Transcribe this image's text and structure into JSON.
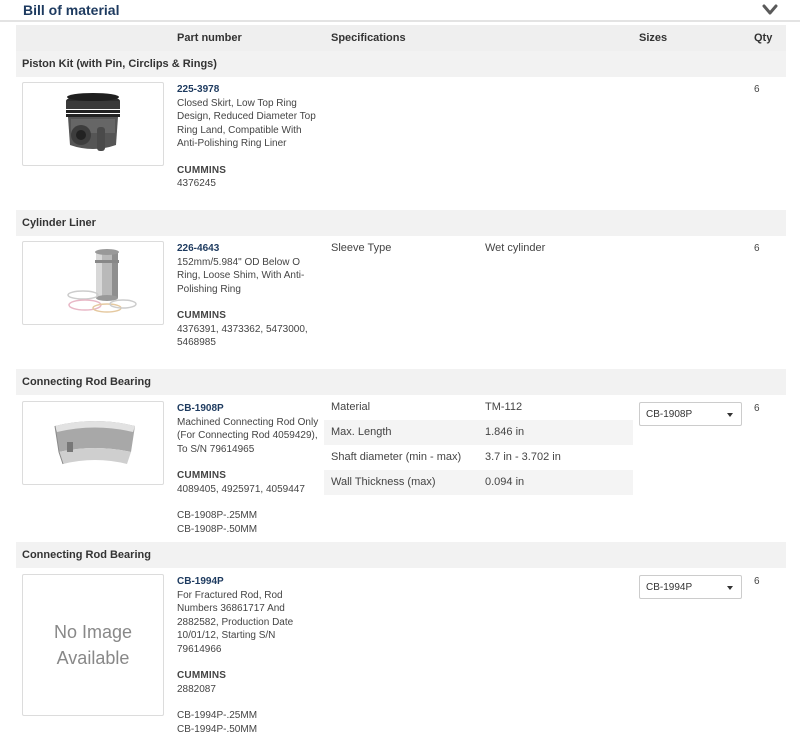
{
  "section_title": "Bill of material",
  "columns": {
    "part_number": "Part number",
    "specifications": "Specifications",
    "sizes": "Sizes",
    "qty": "Qty"
  },
  "groups": [
    {
      "name": "Piston Kit (with Pin, Circlips & Rings)",
      "part_number": "225-3978",
      "description": "Closed Skirt, Low Top Ring Design, Reduced Diameter Top Ring Land, Compatible With Anti-Polishing Ring Liner",
      "brand": "CUMMINS",
      "oem_numbers": "4376245",
      "qty": "6"
    },
    {
      "name": "Cylinder Liner",
      "part_number": "226-4643",
      "description": "152mm/5.984\" OD Below O Ring, Loose Shim, With Anti-Polishing Ring",
      "brand": "CUMMINS",
      "oem_numbers": "4376391, 4373362, 5473000, 5468985",
      "spec_label": "Sleeve Type",
      "spec_value": "Wet cylinder",
      "qty": "6"
    },
    {
      "name": "Connecting Rod Bearing",
      "part_number": "CB-1908P",
      "description": "Machined Connecting Rod Only (For Connecting Rod 4059429), To S/N 79614965",
      "brand": "CUMMINS",
      "oem_numbers": "4089405, 4925971, 4059447",
      "alt1": "CB-1908P-.25MM",
      "alt2": "CB-1908P-.50MM",
      "specs": [
        {
          "label": "Material",
          "value": "TM-112"
        },
        {
          "label": "Max. Length",
          "value": "1.846 in"
        },
        {
          "label": "Shaft diameter (min - max)",
          "value": "3.7 in - 3.702 in"
        },
        {
          "label": "Wall Thickness (max)",
          "value": "0.094 in"
        }
      ],
      "size": "CB-1908P",
      "qty": "6"
    },
    {
      "name": "Connecting Rod Bearing",
      "no_image_line1": "No Image",
      "no_image_line2": "Available",
      "part_number": "CB-1994P",
      "description": "For Fractured Rod, Rod Numbers 36861717 And 2882582, Production Date 10/01/12, Starting S/N 79614966",
      "brand": "CUMMINS",
      "oem_numbers": "2882087",
      "alt1": "CB-1994P-.25MM",
      "alt2": "CB-1994P-.50MM",
      "size": "CB-1994P",
      "qty": "6"
    }
  ],
  "icons": {
    "collapse": "chevron-down-icon",
    "dropdown": "caret-down-icon"
  },
  "colors": {
    "title": "#1d3a5f",
    "header_bg": "#efefef",
    "group_bg": "#f2f2f2"
  }
}
